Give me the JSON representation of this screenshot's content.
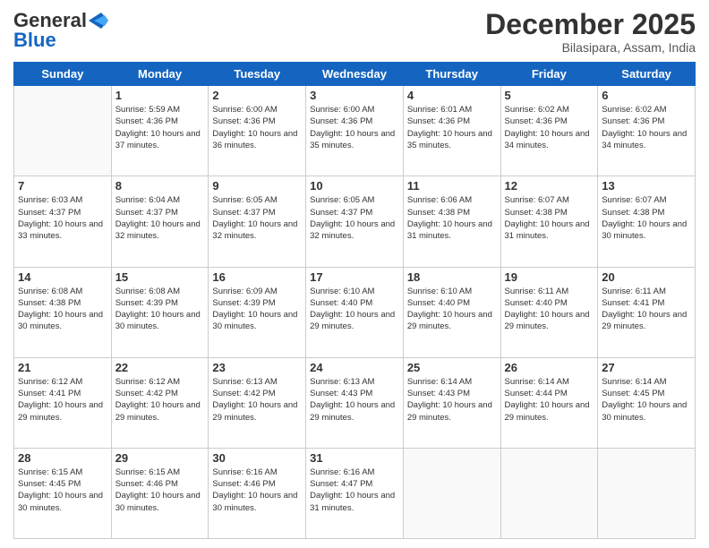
{
  "logo": {
    "line1": "General",
    "line2": "Blue"
  },
  "title": "December 2025",
  "subtitle": "Bilasipara, Assam, India",
  "days_header": [
    "Sunday",
    "Monday",
    "Tuesday",
    "Wednesday",
    "Thursday",
    "Friday",
    "Saturday"
  ],
  "weeks": [
    [
      {
        "day": "",
        "sunrise": "",
        "sunset": "",
        "daylight": ""
      },
      {
        "day": "1",
        "sunrise": "Sunrise: 5:59 AM",
        "sunset": "Sunset: 4:36 PM",
        "daylight": "Daylight: 10 hours and 37 minutes."
      },
      {
        "day": "2",
        "sunrise": "Sunrise: 6:00 AM",
        "sunset": "Sunset: 4:36 PM",
        "daylight": "Daylight: 10 hours and 36 minutes."
      },
      {
        "day": "3",
        "sunrise": "Sunrise: 6:00 AM",
        "sunset": "Sunset: 4:36 PM",
        "daylight": "Daylight: 10 hours and 35 minutes."
      },
      {
        "day": "4",
        "sunrise": "Sunrise: 6:01 AM",
        "sunset": "Sunset: 4:36 PM",
        "daylight": "Daylight: 10 hours and 35 minutes."
      },
      {
        "day": "5",
        "sunrise": "Sunrise: 6:02 AM",
        "sunset": "Sunset: 4:36 PM",
        "daylight": "Daylight: 10 hours and 34 minutes."
      },
      {
        "day": "6",
        "sunrise": "Sunrise: 6:02 AM",
        "sunset": "Sunset: 4:36 PM",
        "daylight": "Daylight: 10 hours and 34 minutes."
      }
    ],
    [
      {
        "day": "7",
        "sunrise": "Sunrise: 6:03 AM",
        "sunset": "Sunset: 4:37 PM",
        "daylight": "Daylight: 10 hours and 33 minutes."
      },
      {
        "day": "8",
        "sunrise": "Sunrise: 6:04 AM",
        "sunset": "Sunset: 4:37 PM",
        "daylight": "Daylight: 10 hours and 32 minutes."
      },
      {
        "day": "9",
        "sunrise": "Sunrise: 6:05 AM",
        "sunset": "Sunset: 4:37 PM",
        "daylight": "Daylight: 10 hours and 32 minutes."
      },
      {
        "day": "10",
        "sunrise": "Sunrise: 6:05 AM",
        "sunset": "Sunset: 4:37 PM",
        "daylight": "Daylight: 10 hours and 32 minutes."
      },
      {
        "day": "11",
        "sunrise": "Sunrise: 6:06 AM",
        "sunset": "Sunset: 4:38 PM",
        "daylight": "Daylight: 10 hours and 31 minutes."
      },
      {
        "day": "12",
        "sunrise": "Sunrise: 6:07 AM",
        "sunset": "Sunset: 4:38 PM",
        "daylight": "Daylight: 10 hours and 31 minutes."
      },
      {
        "day": "13",
        "sunrise": "Sunrise: 6:07 AM",
        "sunset": "Sunset: 4:38 PM",
        "daylight": "Daylight: 10 hours and 30 minutes."
      }
    ],
    [
      {
        "day": "14",
        "sunrise": "Sunrise: 6:08 AM",
        "sunset": "Sunset: 4:38 PM",
        "daylight": "Daylight: 10 hours and 30 minutes."
      },
      {
        "day": "15",
        "sunrise": "Sunrise: 6:08 AM",
        "sunset": "Sunset: 4:39 PM",
        "daylight": "Daylight: 10 hours and 30 minutes."
      },
      {
        "day": "16",
        "sunrise": "Sunrise: 6:09 AM",
        "sunset": "Sunset: 4:39 PM",
        "daylight": "Daylight: 10 hours and 30 minutes."
      },
      {
        "day": "17",
        "sunrise": "Sunrise: 6:10 AM",
        "sunset": "Sunset: 4:40 PM",
        "daylight": "Daylight: 10 hours and 29 minutes."
      },
      {
        "day": "18",
        "sunrise": "Sunrise: 6:10 AM",
        "sunset": "Sunset: 4:40 PM",
        "daylight": "Daylight: 10 hours and 29 minutes."
      },
      {
        "day": "19",
        "sunrise": "Sunrise: 6:11 AM",
        "sunset": "Sunset: 4:40 PM",
        "daylight": "Daylight: 10 hours and 29 minutes."
      },
      {
        "day": "20",
        "sunrise": "Sunrise: 6:11 AM",
        "sunset": "Sunset: 4:41 PM",
        "daylight": "Daylight: 10 hours and 29 minutes."
      }
    ],
    [
      {
        "day": "21",
        "sunrise": "Sunrise: 6:12 AM",
        "sunset": "Sunset: 4:41 PM",
        "daylight": "Daylight: 10 hours and 29 minutes."
      },
      {
        "day": "22",
        "sunrise": "Sunrise: 6:12 AM",
        "sunset": "Sunset: 4:42 PM",
        "daylight": "Daylight: 10 hours and 29 minutes."
      },
      {
        "day": "23",
        "sunrise": "Sunrise: 6:13 AM",
        "sunset": "Sunset: 4:42 PM",
        "daylight": "Daylight: 10 hours and 29 minutes."
      },
      {
        "day": "24",
        "sunrise": "Sunrise: 6:13 AM",
        "sunset": "Sunset: 4:43 PM",
        "daylight": "Daylight: 10 hours and 29 minutes."
      },
      {
        "day": "25",
        "sunrise": "Sunrise: 6:14 AM",
        "sunset": "Sunset: 4:43 PM",
        "daylight": "Daylight: 10 hours and 29 minutes."
      },
      {
        "day": "26",
        "sunrise": "Sunrise: 6:14 AM",
        "sunset": "Sunset: 4:44 PM",
        "daylight": "Daylight: 10 hours and 29 minutes."
      },
      {
        "day": "27",
        "sunrise": "Sunrise: 6:14 AM",
        "sunset": "Sunset: 4:45 PM",
        "daylight": "Daylight: 10 hours and 30 minutes."
      }
    ],
    [
      {
        "day": "28",
        "sunrise": "Sunrise: 6:15 AM",
        "sunset": "Sunset: 4:45 PM",
        "daylight": "Daylight: 10 hours and 30 minutes."
      },
      {
        "day": "29",
        "sunrise": "Sunrise: 6:15 AM",
        "sunset": "Sunset: 4:46 PM",
        "daylight": "Daylight: 10 hours and 30 minutes."
      },
      {
        "day": "30",
        "sunrise": "Sunrise: 6:16 AM",
        "sunset": "Sunset: 4:46 PM",
        "daylight": "Daylight: 10 hours and 30 minutes."
      },
      {
        "day": "31",
        "sunrise": "Sunrise: 6:16 AM",
        "sunset": "Sunset: 4:47 PM",
        "daylight": "Daylight: 10 hours and 31 minutes."
      },
      {
        "day": "",
        "sunrise": "",
        "sunset": "",
        "daylight": ""
      },
      {
        "day": "",
        "sunrise": "",
        "sunset": "",
        "daylight": ""
      },
      {
        "day": "",
        "sunrise": "",
        "sunset": "",
        "daylight": ""
      }
    ]
  ]
}
